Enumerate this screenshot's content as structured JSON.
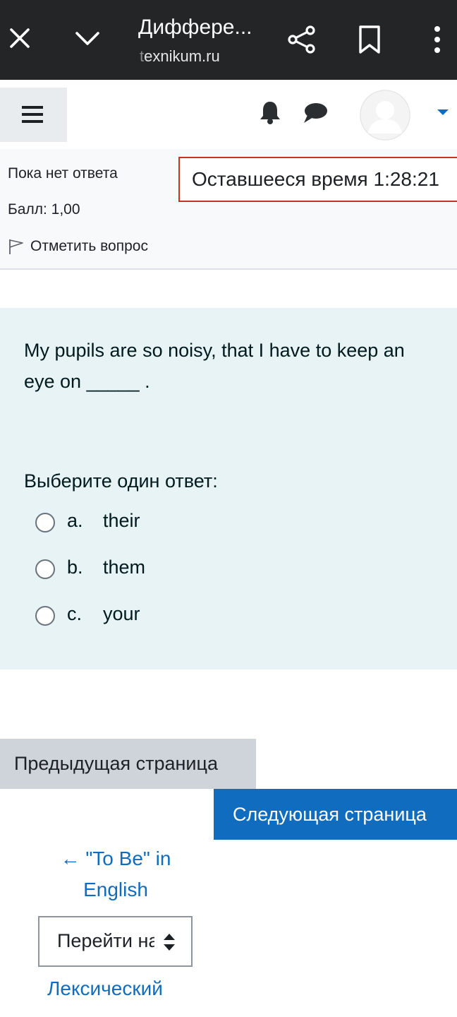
{
  "browser": {
    "title": "Диффере...",
    "url_faded": "t",
    "url_main": "exnikum.ru",
    "icons": [
      "close-icon",
      "chevron-down-icon",
      "share-icon",
      "bookmark-icon",
      "more-vert-icon"
    ]
  },
  "header": {
    "icons": [
      "hamburger-icon",
      "bell-icon",
      "chat-icon",
      "avatar",
      "caret-down-icon"
    ]
  },
  "question_info": {
    "state": "Пока нет ответа",
    "grade": "Балл: 1,00",
    "flag_label": "Отметить вопрос"
  },
  "timer": {
    "text": "Оставшееся время 1:28:21"
  },
  "question": {
    "text": "My pupils are so noisy, that I have to keep an eye on _____ .",
    "prompt": "Выберите один ответ:",
    "answers": [
      {
        "letter": "a.",
        "text": "their",
        "selected": false
      },
      {
        "letter": "b.",
        "text": "them",
        "selected": false
      },
      {
        "letter": "c.",
        "text": "your",
        "selected": false
      }
    ]
  },
  "navigation": {
    "prev_label": "Предыдущая страница",
    "next_label": "Следующая страница",
    "prev_activity": "← \"To Be\" in English",
    "jump_label": "Перейти на...",
    "next_activity": "Лексический"
  },
  "colors": {
    "brand": "#0f6cbf",
    "timer_border": "#ca3120",
    "question_bg": "#e7f3f5",
    "browser_bar": "#232526"
  }
}
